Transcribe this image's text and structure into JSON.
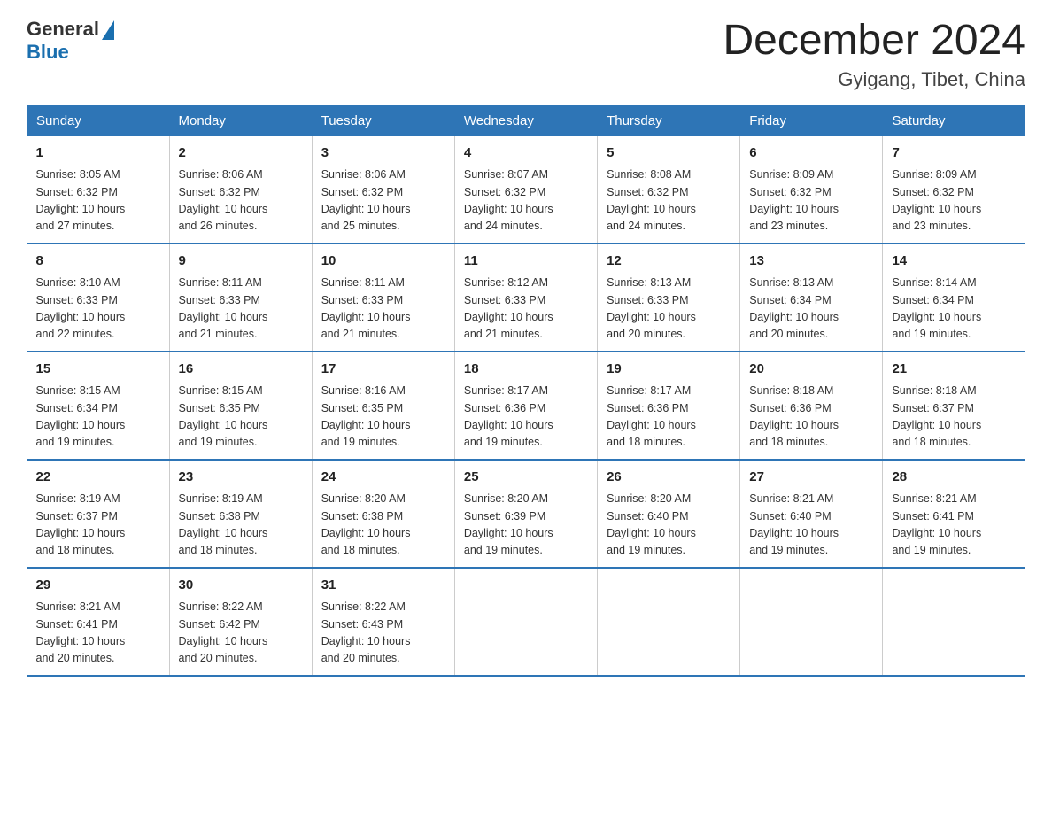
{
  "header": {
    "logo_general": "General",
    "logo_blue": "Blue",
    "title": "December 2024",
    "subtitle": "Gyigang, Tibet, China"
  },
  "days_of_week": [
    "Sunday",
    "Monday",
    "Tuesday",
    "Wednesday",
    "Thursday",
    "Friday",
    "Saturday"
  ],
  "weeks": [
    [
      {
        "day": "1",
        "sunrise": "8:05 AM",
        "sunset": "6:32 PM",
        "daylight": "10 hours and 27 minutes."
      },
      {
        "day": "2",
        "sunrise": "8:06 AM",
        "sunset": "6:32 PM",
        "daylight": "10 hours and 26 minutes."
      },
      {
        "day": "3",
        "sunrise": "8:06 AM",
        "sunset": "6:32 PM",
        "daylight": "10 hours and 25 minutes."
      },
      {
        "day": "4",
        "sunrise": "8:07 AM",
        "sunset": "6:32 PM",
        "daylight": "10 hours and 24 minutes."
      },
      {
        "day": "5",
        "sunrise": "8:08 AM",
        "sunset": "6:32 PM",
        "daylight": "10 hours and 24 minutes."
      },
      {
        "day": "6",
        "sunrise": "8:09 AM",
        "sunset": "6:32 PM",
        "daylight": "10 hours and 23 minutes."
      },
      {
        "day": "7",
        "sunrise": "8:09 AM",
        "sunset": "6:32 PM",
        "daylight": "10 hours and 23 minutes."
      }
    ],
    [
      {
        "day": "8",
        "sunrise": "8:10 AM",
        "sunset": "6:33 PM",
        "daylight": "10 hours and 22 minutes."
      },
      {
        "day": "9",
        "sunrise": "8:11 AM",
        "sunset": "6:33 PM",
        "daylight": "10 hours and 21 minutes."
      },
      {
        "day": "10",
        "sunrise": "8:11 AM",
        "sunset": "6:33 PM",
        "daylight": "10 hours and 21 minutes."
      },
      {
        "day": "11",
        "sunrise": "8:12 AM",
        "sunset": "6:33 PM",
        "daylight": "10 hours and 21 minutes."
      },
      {
        "day": "12",
        "sunrise": "8:13 AM",
        "sunset": "6:33 PM",
        "daylight": "10 hours and 20 minutes."
      },
      {
        "day": "13",
        "sunrise": "8:13 AM",
        "sunset": "6:34 PM",
        "daylight": "10 hours and 20 minutes."
      },
      {
        "day": "14",
        "sunrise": "8:14 AM",
        "sunset": "6:34 PM",
        "daylight": "10 hours and 19 minutes."
      }
    ],
    [
      {
        "day": "15",
        "sunrise": "8:15 AM",
        "sunset": "6:34 PM",
        "daylight": "10 hours and 19 minutes."
      },
      {
        "day": "16",
        "sunrise": "8:15 AM",
        "sunset": "6:35 PM",
        "daylight": "10 hours and 19 minutes."
      },
      {
        "day": "17",
        "sunrise": "8:16 AM",
        "sunset": "6:35 PM",
        "daylight": "10 hours and 19 minutes."
      },
      {
        "day": "18",
        "sunrise": "8:17 AM",
        "sunset": "6:36 PM",
        "daylight": "10 hours and 19 minutes."
      },
      {
        "day": "19",
        "sunrise": "8:17 AM",
        "sunset": "6:36 PM",
        "daylight": "10 hours and 18 minutes."
      },
      {
        "day": "20",
        "sunrise": "8:18 AM",
        "sunset": "6:36 PM",
        "daylight": "10 hours and 18 minutes."
      },
      {
        "day": "21",
        "sunrise": "8:18 AM",
        "sunset": "6:37 PM",
        "daylight": "10 hours and 18 minutes."
      }
    ],
    [
      {
        "day": "22",
        "sunrise": "8:19 AM",
        "sunset": "6:37 PM",
        "daylight": "10 hours and 18 minutes."
      },
      {
        "day": "23",
        "sunrise": "8:19 AM",
        "sunset": "6:38 PM",
        "daylight": "10 hours and 18 minutes."
      },
      {
        "day": "24",
        "sunrise": "8:20 AM",
        "sunset": "6:38 PM",
        "daylight": "10 hours and 18 minutes."
      },
      {
        "day": "25",
        "sunrise": "8:20 AM",
        "sunset": "6:39 PM",
        "daylight": "10 hours and 19 minutes."
      },
      {
        "day": "26",
        "sunrise": "8:20 AM",
        "sunset": "6:40 PM",
        "daylight": "10 hours and 19 minutes."
      },
      {
        "day": "27",
        "sunrise": "8:21 AM",
        "sunset": "6:40 PM",
        "daylight": "10 hours and 19 minutes."
      },
      {
        "day": "28",
        "sunrise": "8:21 AM",
        "sunset": "6:41 PM",
        "daylight": "10 hours and 19 minutes."
      }
    ],
    [
      {
        "day": "29",
        "sunrise": "8:21 AM",
        "sunset": "6:41 PM",
        "daylight": "10 hours and 20 minutes."
      },
      {
        "day": "30",
        "sunrise": "8:22 AM",
        "sunset": "6:42 PM",
        "daylight": "10 hours and 20 minutes."
      },
      {
        "day": "31",
        "sunrise": "8:22 AM",
        "sunset": "6:43 PM",
        "daylight": "10 hours and 20 minutes."
      },
      {
        "day": "",
        "sunrise": "",
        "sunset": "",
        "daylight": ""
      },
      {
        "day": "",
        "sunrise": "",
        "sunset": "",
        "daylight": ""
      },
      {
        "day": "",
        "sunrise": "",
        "sunset": "",
        "daylight": ""
      },
      {
        "day": "",
        "sunrise": "",
        "sunset": "",
        "daylight": ""
      }
    ]
  ],
  "labels": {
    "sunrise_prefix": "Sunrise: ",
    "sunset_prefix": "Sunset: ",
    "daylight_prefix": "Daylight: "
  }
}
